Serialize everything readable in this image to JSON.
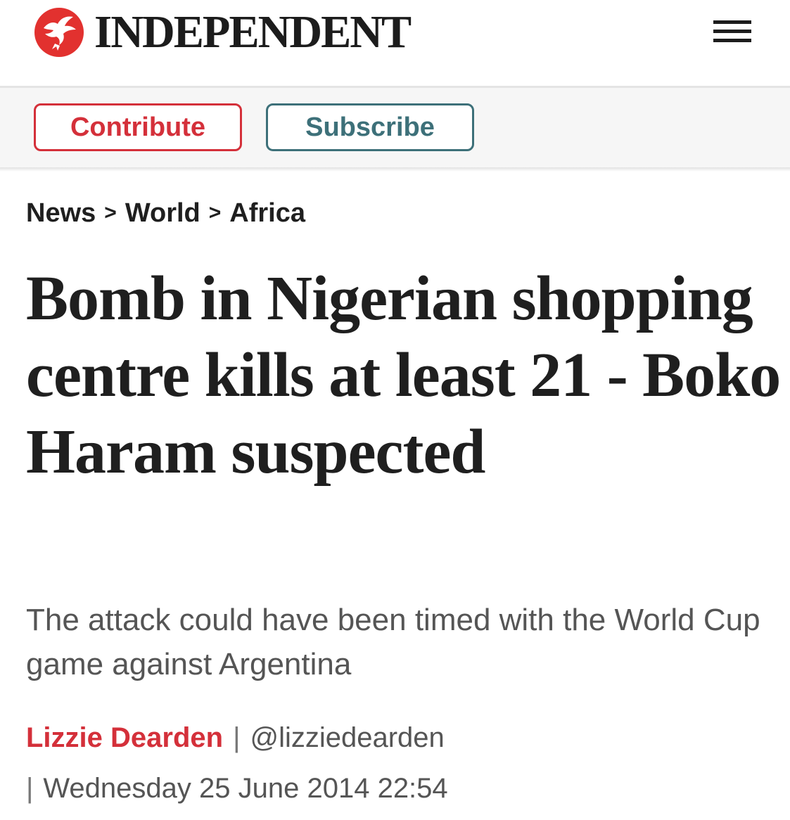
{
  "header": {
    "brand": "INDEPENDENT",
    "logo_icon": "eagle-logo-icon",
    "menu_icon": "hamburger-menu-icon"
  },
  "cta": {
    "contribute_label": "Contribute",
    "subscribe_label": "Subscribe"
  },
  "breadcrumb": {
    "items": [
      "News",
      "World",
      "Africa"
    ],
    "separator": ">"
  },
  "article": {
    "headline": "Bomb in Nigerian shopping centre kills at least 21 - Boko Haram suspected",
    "standfirst": "The attack could have been timed with the World Cup game against Argentina",
    "author": "Lizzie Dearden",
    "handle": "@lizziedearden",
    "date": "Wednesday 25 June 2014 22:54",
    "separator": "|"
  },
  "colors": {
    "brand_red": "#d4303a",
    "subscribe_teal": "#3d7079",
    "text_dark": "#1f1f1f",
    "text_grey": "#555555"
  }
}
